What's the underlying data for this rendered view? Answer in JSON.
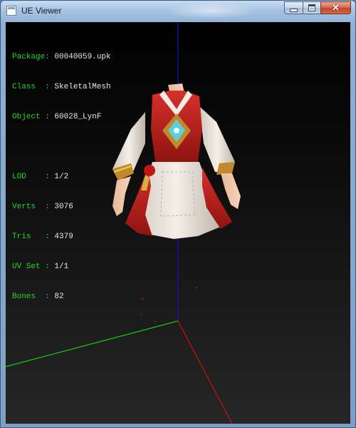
{
  "window": {
    "title": "UE Viewer",
    "icon": "app-window-icon"
  },
  "caption_buttons": {
    "minimize": "minimize-icon",
    "maximize": "maximize-icon",
    "close": "close-icon",
    "close_glyph": "✕"
  },
  "info": {
    "package": {
      "key": "Package: ",
      "value": "00040059.upk"
    },
    "class": {
      "key": "Class  : ",
      "value": "SkeletalMesh"
    },
    "object": {
      "key": "Object : ",
      "value": "60028_LynF"
    },
    "lod": {
      "key": "LOD    : ",
      "value": "1/2"
    },
    "verts": {
      "key": "Verts  : ",
      "value": "3076"
    },
    "tris": {
      "key": "Tris   : ",
      "value": "4379"
    },
    "uvset": {
      "key": "UV Set : ",
      "value": "1/1"
    },
    "bones": {
      "key": "Bones  : ",
      "value": "82"
    }
  },
  "colors": {
    "label_green": "#20d820",
    "axis_x": "#cc1111",
    "axis_y": "#11cc11",
    "axis_z": "#1111cc"
  }
}
